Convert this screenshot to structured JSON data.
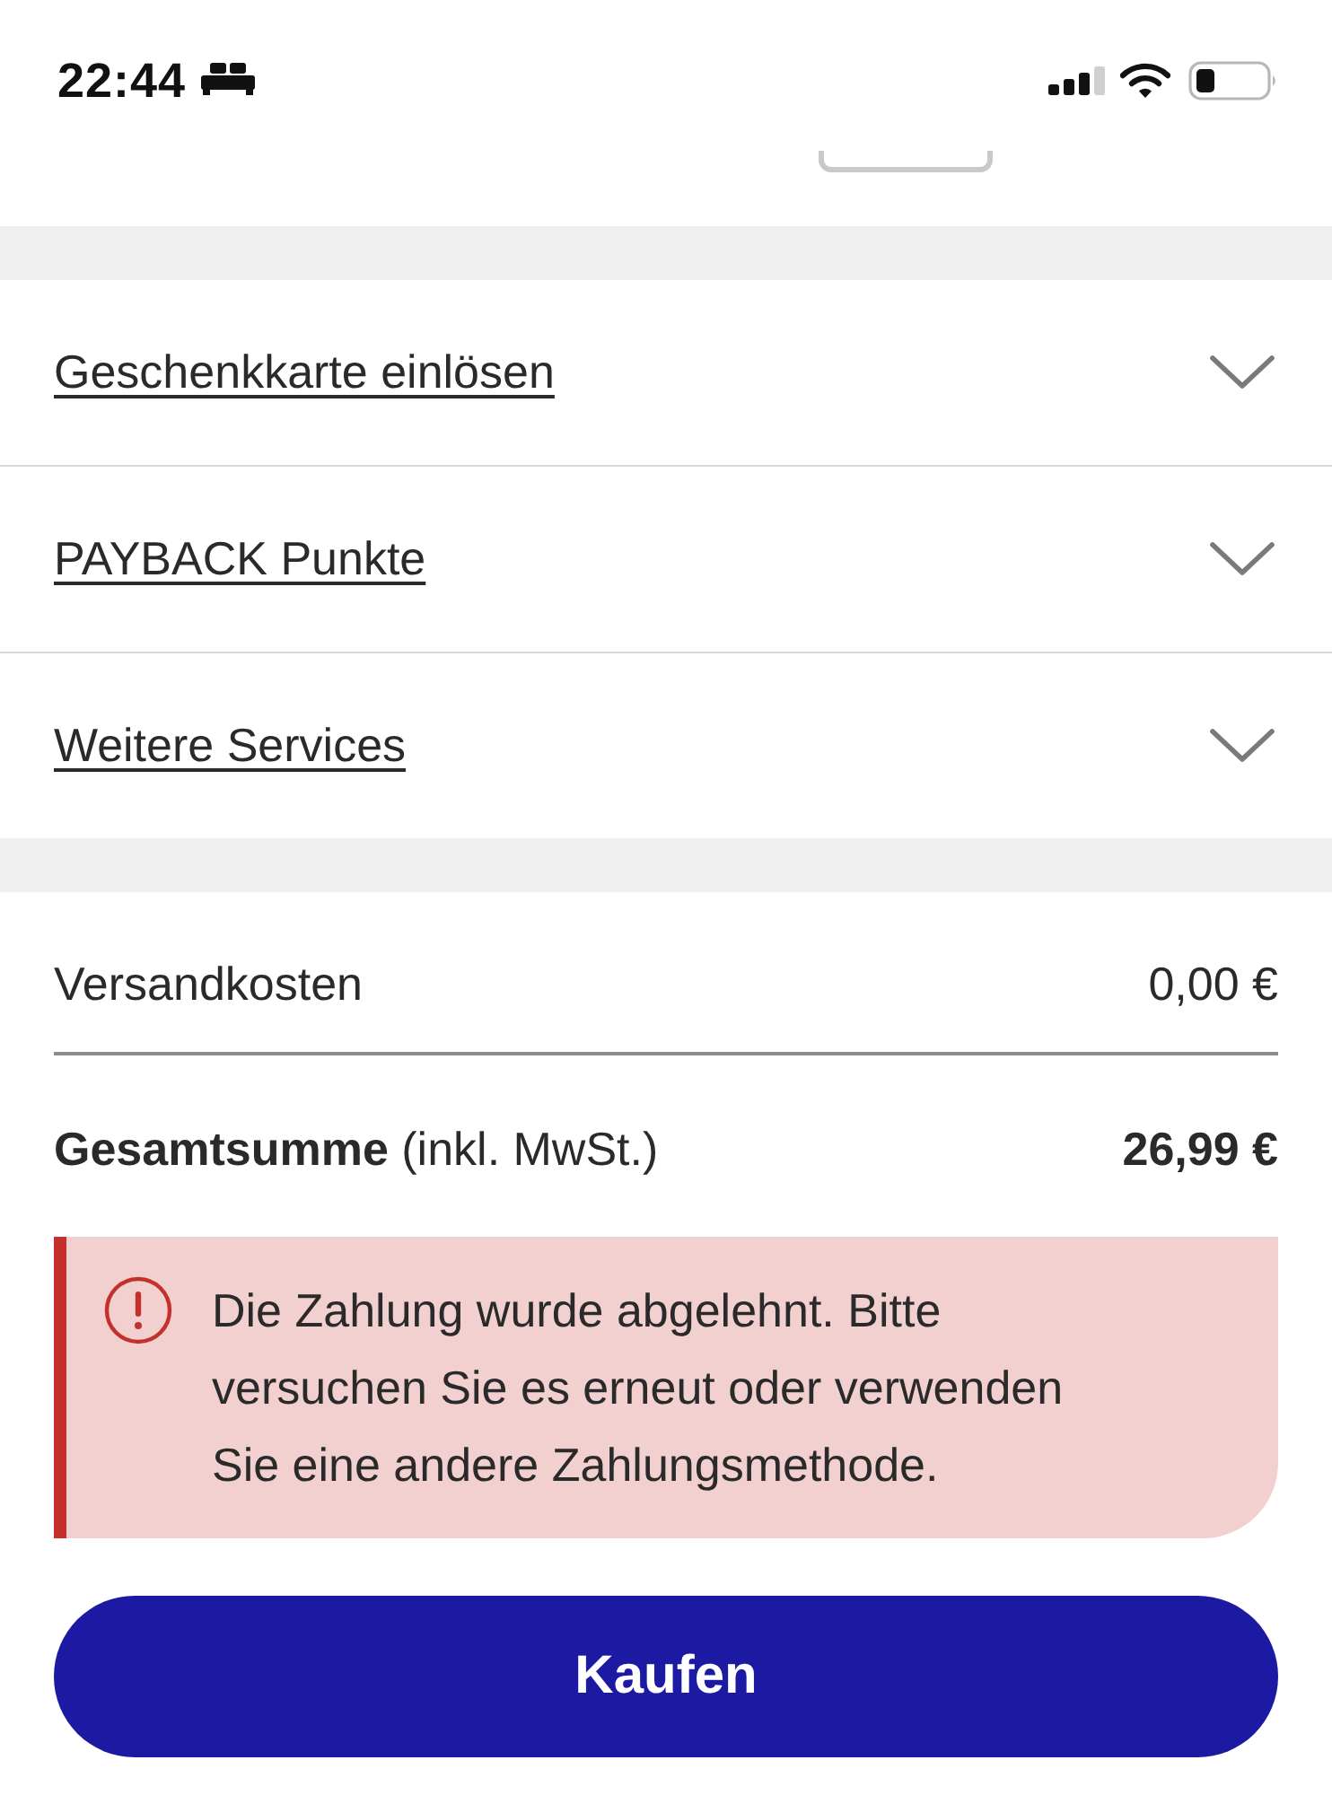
{
  "status_bar": {
    "time": "22:44"
  },
  "accordion": [
    {
      "label": "Geschenkkarte einlösen",
      "expanded": false
    },
    {
      "label": "PAYBACK Punkte",
      "expanded": false
    },
    {
      "label": "Weitere Services",
      "expanded": false
    }
  ],
  "summary": [
    {
      "kind": "plain",
      "label": "Versandkosten",
      "value": "0,00 €"
    },
    {
      "kind": "total",
      "label": "**Gesamtsumme** (inkl. MwSt.)",
      "value": "26,99 €"
    }
  ],
  "alert": {
    "kind": "error",
    "message": "Die Zahlung wurde abgelehnt. Bitte versuchen Sie es erneut oder verwenden Sie eine andere Zahlungsmethode."
  },
  "buy_button": {
    "label": "Kaufen"
  }
}
